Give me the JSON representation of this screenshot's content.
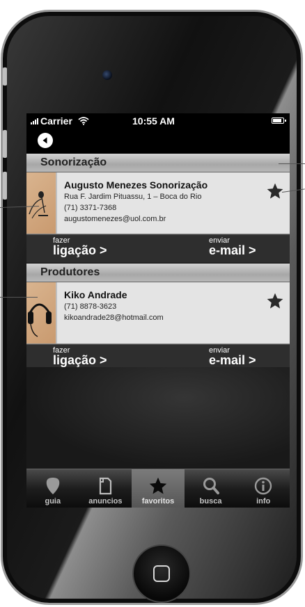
{
  "status": {
    "carrier": "Carrier",
    "time": "10:55 AM"
  },
  "sections": [
    {
      "title": "Sonorização",
      "entry": {
        "name": "Augusto Menezes Sonorização",
        "address": "Rua F. Jardim Pituassu, 1 – Boca do Rio",
        "phone": "(71) 3371-7368",
        "email": "augustomenezes@uol.com.br",
        "thumb_icon": "microphone-icon"
      },
      "actions": {
        "call_small": "fazer",
        "call_big": "ligação >",
        "mail_small": "enviar",
        "mail_big": "e-mail >"
      }
    },
    {
      "title": "Produtores",
      "entry": {
        "name": "Kiko Andrade",
        "phone": "(71) 8878-3623",
        "email": "kikoandrade28@hotmail.com",
        "thumb_icon": "headphones-icon"
      },
      "actions": {
        "call_small": "fazer",
        "call_big": "ligação >",
        "mail_small": "enviar",
        "mail_big": "e-mail >"
      }
    }
  ],
  "tabs": [
    {
      "label": "guia",
      "icon": "guitar-pick-icon"
    },
    {
      "label": "anuncios",
      "icon": "document-icon"
    },
    {
      "label": "favoritos",
      "icon": "star-icon",
      "active": true
    },
    {
      "label": "busca",
      "icon": "search-icon"
    },
    {
      "label": "info",
      "icon": "info-icon"
    }
  ],
  "colors": {
    "accent": "#000000",
    "header_bg": "#b0b0b0",
    "card_bg": "#e4e4e4",
    "action_bg": "#2e2e2e"
  }
}
